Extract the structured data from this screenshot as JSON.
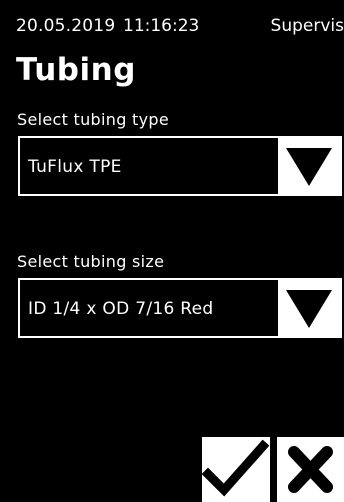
{
  "status": {
    "date": "20.05.2019",
    "time": "11:16:23",
    "user": "Supervis"
  },
  "page": {
    "title": "Tubing"
  },
  "tubing_type": {
    "label": "Select tubing type",
    "value": "TuFlux TPE",
    "arrow_icon": "triangle-down-icon"
  },
  "tubing_size": {
    "label": "Select tubing size",
    "value": "ID 1/4 x OD 7/16 Red",
    "arrow_icon": "triangle-down-icon"
  },
  "actions": {
    "confirm_icon": "checkmark-icon",
    "cancel_icon": "cross-icon"
  },
  "colors": {
    "background": "#000000",
    "foreground": "#ffffff"
  }
}
